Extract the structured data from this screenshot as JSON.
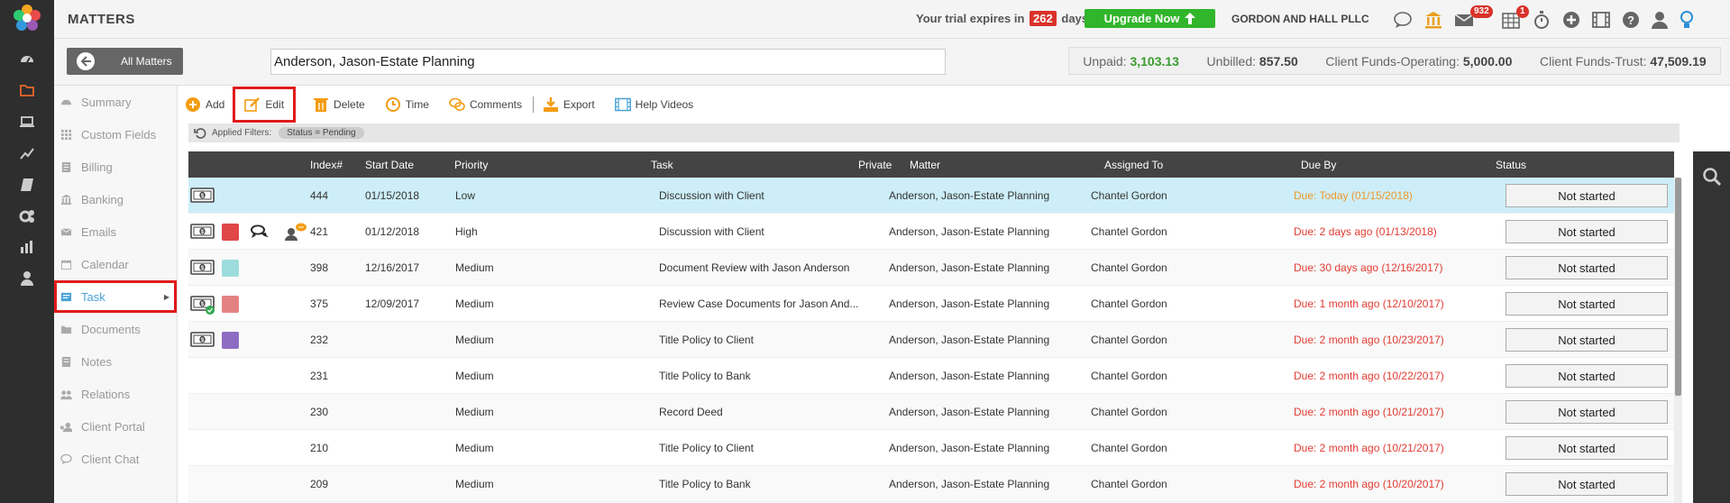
{
  "app": {
    "title": "MATTERS"
  },
  "trial": {
    "prefix": "Your trial expires in",
    "days": "262",
    "suffix": "days."
  },
  "upgrade": {
    "label": "Upgrade Now"
  },
  "firm": {
    "name": "GORDON AND HALL PLLC"
  },
  "notifications": {
    "mail_count": "932",
    "calendar_count": "1"
  },
  "back_button": {
    "label": "All Matters"
  },
  "matter": {
    "name": "Anderson, Jason-Estate Planning"
  },
  "finance": {
    "unpaid_label": "Unpaid:",
    "unpaid_value": "3,103.13",
    "unbilled_label": "Unbilled:",
    "unbilled_value": "857.50",
    "operating_label": "Client Funds-Operating:",
    "operating_value": "5,000.00",
    "trust_label": "Client Funds-Trust:",
    "trust_value": "47,509.19"
  },
  "nav": [
    {
      "label": "Summary",
      "icon": "dashboard-icon"
    },
    {
      "label": "Custom Fields",
      "icon": "grid-icon"
    },
    {
      "label": "Billing",
      "icon": "billing-icon"
    },
    {
      "label": "Banking",
      "icon": "bank-icon"
    },
    {
      "label": "Emails",
      "icon": "envelope-icon"
    },
    {
      "label": "Calendar",
      "icon": "calendar-icon"
    },
    {
      "label": "Task",
      "icon": "task-icon",
      "active": true
    },
    {
      "label": "Documents",
      "icon": "folder-icon"
    },
    {
      "label": "Notes",
      "icon": "notes-icon"
    },
    {
      "label": "Relations",
      "icon": "people-icon"
    },
    {
      "label": "Client Portal",
      "icon": "portal-icon"
    },
    {
      "label": "Client Chat",
      "icon": "chat-icon"
    }
  ],
  "toolbar": {
    "add": "Add",
    "edit": "Edit",
    "delete": "Delete",
    "time": "Time",
    "comments": "Comments",
    "export": "Export",
    "help": "Help Videos"
  },
  "filters": {
    "label": "Applied Filters:",
    "chip": "Status = Pending"
  },
  "columns": {
    "index": "Index#",
    "start": "Start Date",
    "priority": "Priority",
    "task": "Task",
    "private": "Private",
    "matter": "Matter",
    "assigned": "Assigned To",
    "due": "Due By",
    "status": "Status"
  },
  "rows": [
    {
      "index": "444",
      "start": "01/15/2018",
      "priority": "Low",
      "task": "Discussion with Client",
      "matter": "Anderson, Jason-Estate Planning",
      "assigned": "Chantel Gordon",
      "due": "Due: Today (01/15/2018)",
      "status": "Not started",
      "color": "",
      "due_color": "#f0972b"
    },
    {
      "index": "421",
      "start": "01/12/2018",
      "priority": "High",
      "task": "Discussion with Client",
      "matter": "Anderson, Jason-Estate Planning",
      "assigned": "Chantel Gordon",
      "due": "Due: 2 days ago (01/13/2018)",
      "status": "Not started",
      "color": "#e04848",
      "due_color": "#e23b32"
    },
    {
      "index": "398",
      "start": "12/16/2017",
      "priority": "Medium",
      "task": "Document Review with Jason Anderson",
      "matter": "Anderson, Jason-Estate Planning",
      "assigned": "Chantel Gordon",
      "due": "Due: 30 days ago (12/16/2017)",
      "status": "Not started",
      "color": "#9ddcdc",
      "due_color": "#e23b32"
    },
    {
      "index": "375",
      "start": "12/09/2017",
      "priority": "Medium",
      "task": "Review Case Documents for Jason And...",
      "matter": "Anderson, Jason-Estate Planning",
      "assigned": "Chantel Gordon",
      "due": "Due: 1 month ago (12/10/2017)",
      "status": "Not started",
      "color": "#e48282",
      "due_color": "#e23b32"
    },
    {
      "index": "232",
      "start": "",
      "priority": "Medium",
      "task": "Title Policy to Client",
      "matter": "Anderson, Jason-Estate Planning",
      "assigned": "Chantel Gordon",
      "due": "Due: 2 month ago (10/23/2017)",
      "status": "Not started",
      "color": "#8e6cc4",
      "due_color": "#e23b32"
    },
    {
      "index": "231",
      "start": "",
      "priority": "Medium",
      "task": "Title Policy to Bank",
      "matter": "Anderson, Jason-Estate Planning",
      "assigned": "Chantel Gordon",
      "due": "Due: 2 month ago (10/22/2017)",
      "status": "Not started",
      "color": "",
      "due_color": "#e23b32"
    },
    {
      "index": "230",
      "start": "",
      "priority": "Medium",
      "task": "Record Deed",
      "matter": "Anderson, Jason-Estate Planning",
      "assigned": "Chantel Gordon",
      "due": "Due: 2 month ago (10/21/2017)",
      "status": "Not started",
      "color": "",
      "due_color": "#e23b32"
    },
    {
      "index": "210",
      "start": "",
      "priority": "Medium",
      "task": "Title Policy to Client",
      "matter": "Anderson, Jason-Estate Planning",
      "assigned": "Chantel Gordon",
      "due": "Due: 2 month ago (10/21/2017)",
      "status": "Not started",
      "color": "",
      "due_color": "#e23b32"
    },
    {
      "index": "209",
      "start": "",
      "priority": "Medium",
      "task": "Title Policy to Bank",
      "matter": "Anderson, Jason-Estate Planning",
      "assigned": "Chantel Gordon",
      "due": "Due: 2 month ago (10/20/2017)",
      "status": "Not started",
      "color": "",
      "due_color": "#e23b32"
    }
  ]
}
